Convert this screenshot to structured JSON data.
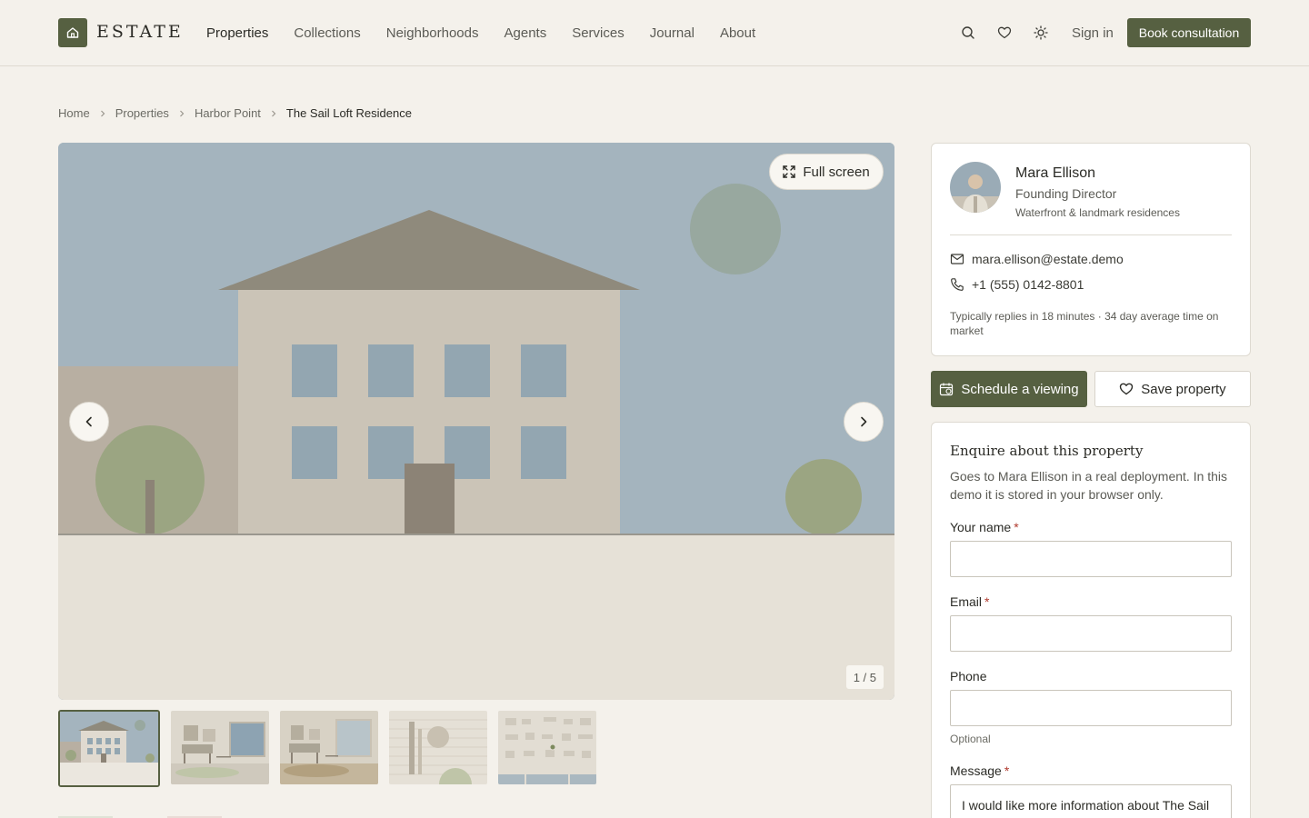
{
  "brand": {
    "name": "ESTATE",
    "accent": "#566041"
  },
  "nav": {
    "items": [
      {
        "label": "Properties",
        "active": true
      },
      {
        "label": "Collections"
      },
      {
        "label": "Neighborhoods"
      },
      {
        "label": "Agents"
      },
      {
        "label": "Services"
      },
      {
        "label": "Journal"
      },
      {
        "label": "About"
      }
    ],
    "icons": [
      "search-icon",
      "heart-icon",
      "sun-icon"
    ],
    "sign_in": "Sign in",
    "cta": "Book consultation"
  },
  "breadcrumb": [
    "Home",
    "Properties",
    "Harbor Point",
    "The Sail Loft Residence"
  ],
  "gallery": {
    "fullscreen_label": "Full screen",
    "counter": "1 / 5",
    "current": 1,
    "total": 5
  },
  "agent": {
    "name": "Mara Ellison",
    "title": "Founding Director",
    "specialty": "Waterfront & landmark residences",
    "email": "mara.ellison@estate.demo",
    "phone": "+1 (555) 0142-8801",
    "note": "Typically replies in 18 minutes · 34 day average time on market"
  },
  "actions": {
    "schedule": "Schedule a viewing",
    "save": "Save property"
  },
  "enquiry": {
    "title": "Enquire about this property",
    "description": "Goes to Mara Ellison in a real deployment. In this demo it is stored in your browser only.",
    "name_label": "Your name",
    "email_label": "Email",
    "phone_label": "Phone",
    "phone_hint": "Optional",
    "message_label": "Message",
    "required_mark": "*",
    "message_value": "I would like more information about The Sail Loft Residence."
  }
}
